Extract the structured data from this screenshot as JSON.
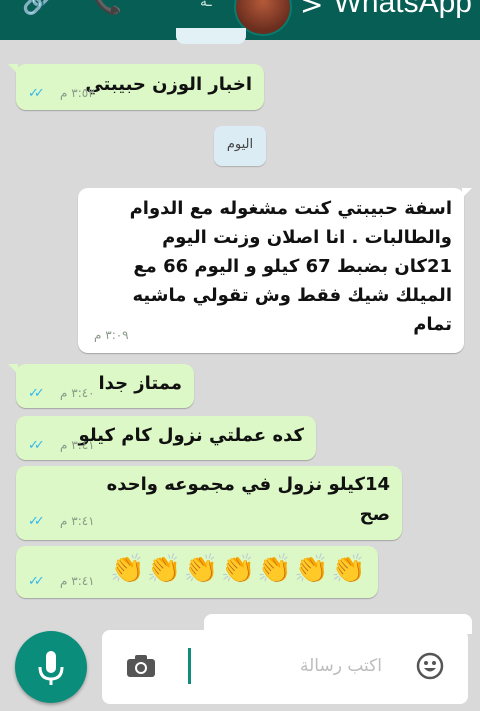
{
  "header": {
    "app_title": "WhatsApp",
    "back_glyph": ">",
    "paperclip_glyph": "🔗",
    "phone_glyph": "📞"
  },
  "chat": {
    "date_separator": "اليوم",
    "messages": [
      {
        "id": "m1",
        "direction": "outgoing",
        "lines": [
          "اخبار الوزن حبيبتي"
        ],
        "time": "٣:٥٣ م",
        "status": "read"
      },
      {
        "id": "m2",
        "direction": "incoming",
        "lines": [
          "اسفة حبيبتي كنت مشغوله مع الدوام",
          "والطالبات . انا اصلان وزنت اليوم",
          "21كان بضبط 67 كيلو و اليوم 66 مع",
          "الميلك شيك فقط وش تقولي ماشيه",
          "تمام"
        ],
        "time": "٣:٠٩ م"
      },
      {
        "id": "m3",
        "direction": "outgoing",
        "lines": [
          "ممتاز جدا"
        ],
        "time": "٣:٤٠ م",
        "status": "read"
      },
      {
        "id": "m4",
        "direction": "outgoing",
        "lines": [
          "كده عملتي نزول كام كيلو"
        ],
        "time": "٣:٤١ م",
        "status": "read"
      },
      {
        "id": "m5",
        "direction": "outgoing",
        "lines": [
          "14كيلو نزول في مجموعه واحده",
          "صح"
        ],
        "time": "٣:٤١ م",
        "status": "read"
      },
      {
        "id": "m6",
        "direction": "outgoing",
        "lines": [
          "👏👏👏👏👏👏👏"
        ],
        "time": "٣:٤١ م",
        "status": "read"
      }
    ]
  },
  "composer": {
    "placeholder": "اكتب رسالة",
    "icons": [
      "camera-icon",
      "emoji-icon",
      "mic-icon"
    ]
  },
  "ticks_glyph": "✓✓",
  "colors": {
    "header": "#075e54",
    "outgoing_bubble": "#dcf8c6",
    "incoming_bubble": "#ffffff",
    "read_ticks": "#34b7f1",
    "mic_button": "#0b8d7c",
    "background": "#d9d9d9"
  }
}
